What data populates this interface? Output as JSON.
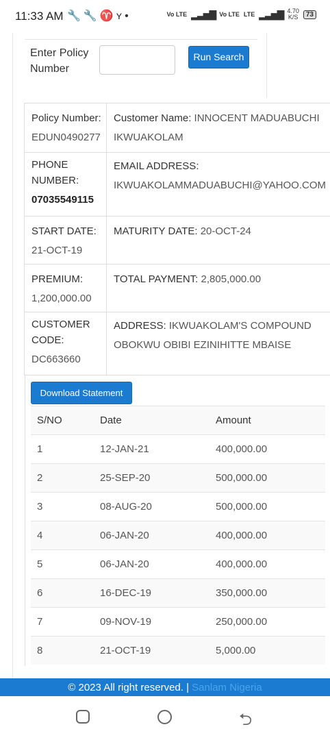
{
  "status_bar": {
    "time": "11:33 AM",
    "icons": [
      "wrench-icon",
      "wrench-icon",
      "trophy-icon",
      "bird-icon",
      "dot-icon"
    ],
    "network1": "Vo LTE",
    "network2": "Vo LTE",
    "network3": "LTE",
    "speed_value": "4.70",
    "speed_unit": "K/S",
    "battery": "73"
  },
  "search": {
    "label": "Enter Policy Number",
    "input_value": "",
    "button_label": "Run Search"
  },
  "policy": {
    "policy_number_label": "Policy Number:",
    "policy_number": "EDUN0490277",
    "customer_name_label": "Customer Name:",
    "customer_name": "INNOCENT MADUABUCHI IKWUAKOLAM",
    "phone_label": "PHONE NUMBER:",
    "phone": "07035549115",
    "email_label": "EMAIL ADDRESS:",
    "email": "IKWUAKOLAMMADUABUCHI@YAHOO.COM",
    "start_date_label": "START DATE:",
    "start_date": "21-OCT-19",
    "maturity_date_label": "MATURITY DATE:",
    "maturity_date": "20-OCT-24",
    "premium_label": "PREMIUM:",
    "premium": "1,200,000.00",
    "total_payment_label": "TOTAL PAYMENT:",
    "total_payment": "2,805,000.00",
    "customer_code_label": "CUSTOMER CODE:",
    "customer_code": "DC663660",
    "address_label": "ADDRESS:",
    "address": "IKWUAKOLAM'S COMPOUND OBOKWU OBIBI EZINIHITTE MBAISE"
  },
  "download_button": "Download Statement",
  "payments": {
    "headers": [
      "S/NO",
      "Date",
      "Amount"
    ],
    "rows": [
      [
        "1",
        "12-JAN-21",
        "400,000.00"
      ],
      [
        "2",
        "25-SEP-20",
        "500,000.00"
      ],
      [
        "3",
        "08-AUG-20",
        "500,000.00"
      ],
      [
        "4",
        "06-JAN-20",
        "400,000.00"
      ],
      [
        "5",
        "06-JAN-20",
        "400,000.00"
      ],
      [
        "6",
        "16-DEC-19",
        "350,000.00"
      ],
      [
        "7",
        "09-NOV-19",
        "250,000.00"
      ],
      [
        "8",
        "21-OCT-19",
        "5,000.00"
      ]
    ]
  },
  "footer": {
    "text": "© 2023 All right reserved. |",
    "brand": "Sanlam Nigeria"
  },
  "colors": {
    "primary": "#1a7bd1",
    "brand_link": "#4aa4ee"
  }
}
